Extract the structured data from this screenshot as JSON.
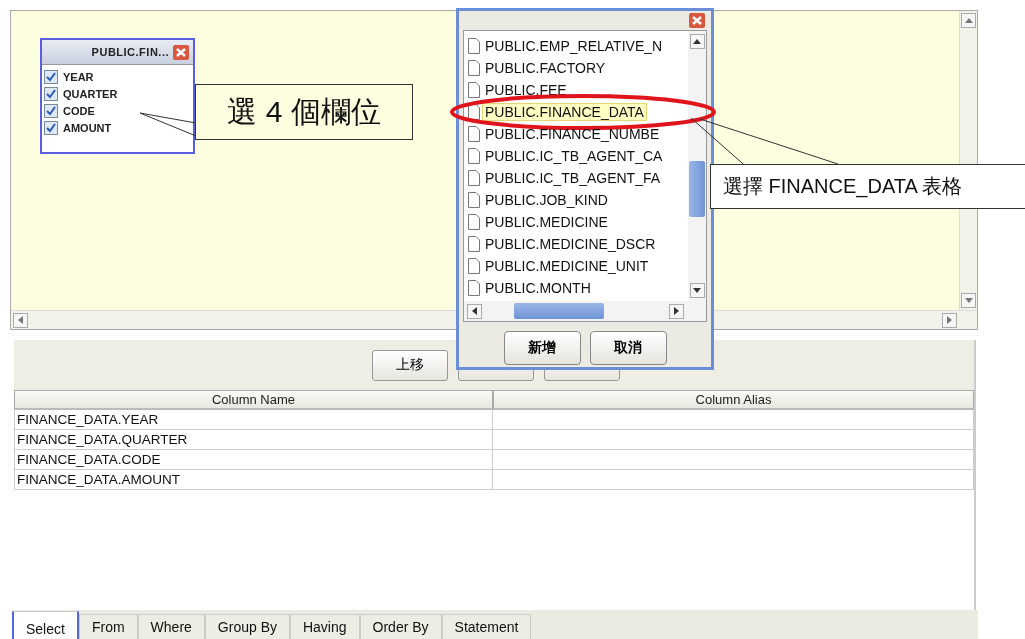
{
  "table_box": {
    "title": "PUBLIC.FIN...",
    "columns": [
      {
        "name": "YEAR",
        "checked": true
      },
      {
        "name": "QUARTER",
        "checked": true
      },
      {
        "name": "CODE",
        "checked": true
      },
      {
        "name": "AMOUNT",
        "checked": true
      }
    ]
  },
  "callouts": [
    {
      "text": "選 4 個欄位"
    },
    {
      "text": "選擇 FINANCE_DATA 表格"
    }
  ],
  "dialog": {
    "items": [
      {
        "label": "PUBLIC.EMP_RELATIVE_N",
        "selected": false
      },
      {
        "label": "PUBLIC.FACTORY",
        "selected": false
      },
      {
        "label": "PUBLIC.FEE",
        "selected": false
      },
      {
        "label": "PUBLIC.FINANCE_DATA",
        "selected": true
      },
      {
        "label": "PUBLIC.FINANCE_NUMBE",
        "selected": false
      },
      {
        "label": "PUBLIC.IC_TB_AGENT_CA",
        "selected": false
      },
      {
        "label": "PUBLIC.IC_TB_AGENT_FA",
        "selected": false
      },
      {
        "label": "PUBLIC.JOB_KIND",
        "selected": false
      },
      {
        "label": "PUBLIC.MEDICINE",
        "selected": false
      },
      {
        "label": "PUBLIC.MEDICINE_DSCR",
        "selected": false
      },
      {
        "label": "PUBLIC.MEDICINE_UNIT",
        "selected": false
      },
      {
        "label": "PUBLIC.MONTH",
        "selected": false
      }
    ],
    "buttons": [
      "新增",
      "取消"
    ]
  },
  "move_up_button": "上移",
  "grid": {
    "columns": [
      "Column Name",
      "Column Alias"
    ],
    "rows": [
      {
        "column_name": "FINANCE_DATA.YEAR"
      },
      {
        "column_name": "FINANCE_DATA.QUARTER"
      },
      {
        "column_name": "FINANCE_DATA.CODE"
      },
      {
        "column_name": "FINANCE_DATA.AMOUNT"
      }
    ]
  },
  "tabs": [
    {
      "label": "Select",
      "selected": true
    },
    {
      "label": "From",
      "selected": false
    },
    {
      "label": "Where",
      "selected": false
    },
    {
      "label": "Group By",
      "selected": false
    },
    {
      "label": "Having",
      "selected": false
    },
    {
      "label": "Order By",
      "selected": false
    },
    {
      "label": "Statement",
      "selected": false
    }
  ]
}
